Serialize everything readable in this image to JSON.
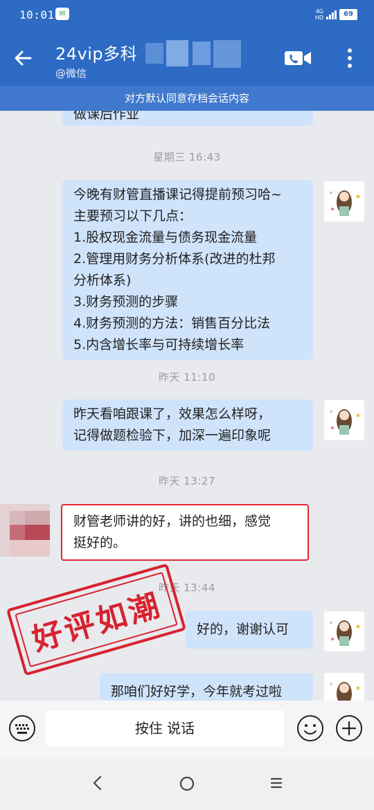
{
  "status": {
    "time": "10:01",
    "network": "4G",
    "hd": "HD",
    "battery": "69"
  },
  "header": {
    "title": "24vip多科",
    "subtitle": "@微信"
  },
  "notice": "对方默认同意存档会话内容",
  "messages": {
    "prev_tail": "做课后作业",
    "t1": "星期三  16:43",
    "m1": [
      "今晚有财管直播课记得提前预习哈~",
      "主要预习以下几点：",
      "1.股权现金流量与债务现金流量",
      "2.管理用财务分析体系(改进的杜邦",
      "分析体系)",
      "3.财务预测的步骤",
      "4.财务预测的方法：销售百分比法",
      "5.内含增长率与可持续增长率"
    ],
    "t2": "昨天  11:10",
    "m2": [
      "昨天看咱跟课了，效果怎么样呀，",
      "记得做题检验下，加深一遍印象呢"
    ],
    "t3": "昨天  13:27",
    "m3": [
      "财管老师讲的好，讲的也细，感觉",
      "挺好的。"
    ],
    "t4": "昨天  13:44",
    "m4": "好的，谢谢认可",
    "m5": "那咱们好好学，今年就考过啦"
  },
  "stamp": "好评如潮",
  "input": {
    "voice_label": "按住 说话"
  },
  "colors": {
    "header": "#2d6bc4",
    "bubble_blue": "#cfe3fb",
    "stamp_red": "#d8222f"
  }
}
